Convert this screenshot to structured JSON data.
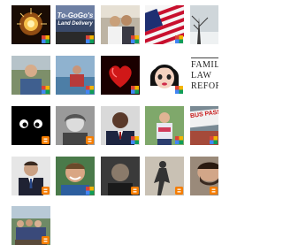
{
  "followers_grid": {
    "tiles": [
      {
        "row": 0,
        "col": 0,
        "name": "fireworks-avatar",
        "badge": "google"
      },
      {
        "row": 0,
        "col": 1,
        "name": "to-gogo-avatar",
        "text_top": "To-GoGo's",
        "text_bottom": "Land Delivery",
        "badge": "google"
      },
      {
        "row": 0,
        "col": 2,
        "name": "couple-photo-avatar",
        "badge": "google"
      },
      {
        "row": 0,
        "col": 3,
        "name": "american-flag-avatar",
        "badge": "google"
      },
      {
        "row": 0,
        "col": 4,
        "name": "winter-tree-avatar",
        "badge": "google"
      },
      {
        "row": 1,
        "col": 0,
        "name": "man-outdoors-avatar",
        "badge": "google"
      },
      {
        "row": 1,
        "col": 1,
        "name": "man-by-lake-avatar",
        "badge": "google"
      },
      {
        "row": 1,
        "col": 2,
        "name": "red-heart-avatar",
        "badge": "google"
      },
      {
        "row": 1,
        "col": 3,
        "name": "cartoon-girl-avatar",
        "badge": "google"
      },
      {
        "row": 1,
        "col": 4,
        "name": "family-law-reform-avatar",
        "lines": [
          "FAMIL",
          "LAW",
          "REFOR"
        ],
        "badge": "none"
      },
      {
        "row": 2,
        "col": 0,
        "name": "cartoon-eyes-avatar",
        "badge": "blogger"
      },
      {
        "row": 2,
        "col": 1,
        "name": "woman-bw-avatar",
        "badge": "blogger"
      },
      {
        "row": 2,
        "col": 2,
        "name": "man-suit-avatar",
        "badge": "google"
      },
      {
        "row": 2,
        "col": 3,
        "name": "woman-tshirt-avatar",
        "badge": "google"
      },
      {
        "row": 2,
        "col": 4,
        "name": "bus-sign-avatar",
        "text_top": "BUS PASS",
        "badge": "google"
      },
      {
        "row": 3,
        "col": 0,
        "name": "man-tie-avatar",
        "badge": "blogger"
      },
      {
        "row": 3,
        "col": 1,
        "name": "man-smiling-avatar",
        "badge": "google"
      },
      {
        "row": 3,
        "col": 2,
        "name": "man-dark-avatar",
        "badge": "blogger"
      },
      {
        "row": 3,
        "col": 3,
        "name": "shadow-avatar",
        "badge": "blogger"
      },
      {
        "row": 3,
        "col": 4,
        "name": "man-beard-avatar",
        "badge": "blogger"
      },
      {
        "row": 4,
        "col": 0,
        "name": "group-photo-avatar",
        "badge": "blogger"
      }
    ]
  },
  "colors": {
    "blogger": "#f57d00",
    "google_red": "#db4437",
    "google_blue": "#4285f4",
    "google_green": "#0f9d58",
    "google_yellow": "#f4b400"
  }
}
